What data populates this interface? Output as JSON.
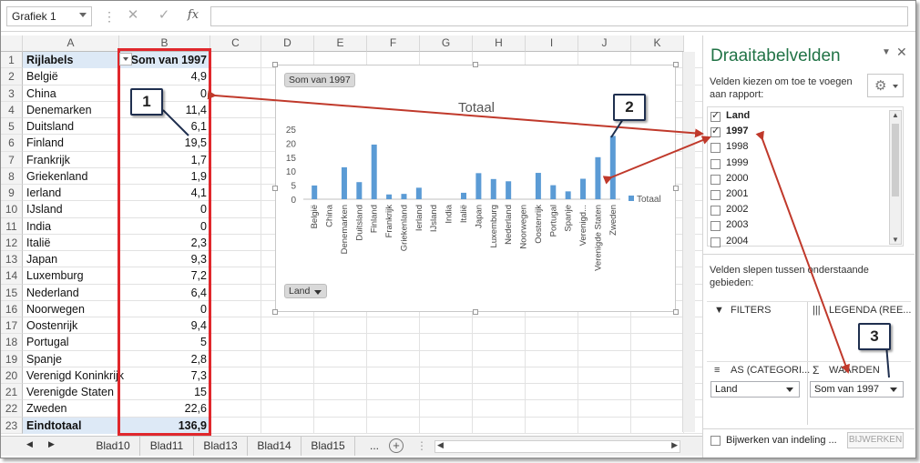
{
  "formula_bar": {
    "name_box": "Grafiek 1",
    "cancel_icon": "✕",
    "enter_icon": "✓",
    "function_icon": "fx"
  },
  "columns": [
    "A",
    "B",
    "C",
    "D",
    "E",
    "F",
    "G",
    "H",
    "I",
    "J",
    "K"
  ],
  "pivot": {
    "header_label": "Rijlabels",
    "header_value": "Som van 1997",
    "rows": [
      {
        "label": "België",
        "value": "4,9"
      },
      {
        "label": "China",
        "value": "0"
      },
      {
        "label": "Denemarken",
        "value": "11,4"
      },
      {
        "label": "Duitsland",
        "value": "6,1"
      },
      {
        "label": "Finland",
        "value": "19,5"
      },
      {
        "label": "Frankrijk",
        "value": "1,7"
      },
      {
        "label": "Griekenland",
        "value": "1,9"
      },
      {
        "label": "Ierland",
        "value": "4,1"
      },
      {
        "label": "IJsland",
        "value": "0"
      },
      {
        "label": "India",
        "value": "0"
      },
      {
        "label": "Italië",
        "value": "2,3"
      },
      {
        "label": "Japan",
        "value": "9,3"
      },
      {
        "label": "Luxemburg",
        "value": "7,2"
      },
      {
        "label": "Nederland",
        "value": "6,4"
      },
      {
        "label": "Noorwegen",
        "value": "0"
      },
      {
        "label": "Oostenrijk",
        "value": "9,4"
      },
      {
        "label": "Portugal",
        "value": "5"
      },
      {
        "label": "Spanje",
        "value": "2,8"
      },
      {
        "label": "Verenigd Koninkrijk",
        "value": "7,3"
      },
      {
        "label": "Verenigde Staten",
        "value": "15"
      },
      {
        "label": "Zweden",
        "value": "22,6"
      }
    ],
    "total_label": "Eindtotaal",
    "total_value": "136,9"
  },
  "chart_data": {
    "type": "bar",
    "title": "Totaal",
    "value_field_button": "Som van 1997",
    "axis_field_button": "Land",
    "categories": [
      "België",
      "China",
      "Denemarken",
      "Duitsland",
      "Finland",
      "Frankrijk",
      "Griekenland",
      "Ierland",
      "IJsland",
      "India",
      "Italië",
      "Japan",
      "Luxemburg",
      "Nederland",
      "Noorwegen",
      "Oostenrijk",
      "Portugal",
      "Spanje",
      "Verenigd...",
      "Verenigde Staten",
      "Zweden"
    ],
    "series": [
      {
        "name": "Totaal",
        "values": [
          4.9,
          0,
          11.4,
          6.1,
          19.5,
          1.7,
          1.9,
          4.1,
          0,
          0,
          2.3,
          9.3,
          7.2,
          6.4,
          0,
          9.4,
          5,
          2.8,
          7.3,
          15,
          22.6
        ]
      }
    ],
    "y_ticks": [
      "0",
      "5",
      "10",
      "15",
      "20",
      "25"
    ],
    "ylim": [
      0,
      25
    ],
    "legend": "right",
    "bar_color": "#5b9bd5"
  },
  "callouts": [
    "1",
    "2",
    "3"
  ],
  "sheet_tabs": [
    "Blad10",
    "Blad11",
    "Blad13",
    "Blad14",
    "Blad15"
  ],
  "tabs_more": "...",
  "panel": {
    "title": "Draaitabelvelden",
    "instruction": "Velden kiezen om toe te voegen aan rapport:",
    "fields": [
      {
        "label": "Land",
        "checked": true,
        "bold": true
      },
      {
        "label": "1997",
        "checked": true,
        "bold": true
      },
      {
        "label": "1998",
        "checked": false,
        "bold": false
      },
      {
        "label": "1999",
        "checked": false,
        "bold": false
      },
      {
        "label": "2000",
        "checked": false,
        "bold": false
      },
      {
        "label": "2001",
        "checked": false,
        "bold": false
      },
      {
        "label": "2002",
        "checked": false,
        "bold": false
      },
      {
        "label": "2003",
        "checked": false,
        "bold": false
      },
      {
        "label": "2004",
        "checked": false,
        "bold": false
      }
    ],
    "drag_text": "Velden slepen tussen onderstaande gebieden:",
    "filters_label": "FILTERS",
    "legend_label": "LEGENDA (REE...",
    "axis_label": "AS (CATEGORI...",
    "values_label": "WAARDEN",
    "axis_value": "Land",
    "values_value": "Som van 1997",
    "defer_label": "Bijwerken van indeling ...",
    "update_button": "BIJWERKEN"
  }
}
